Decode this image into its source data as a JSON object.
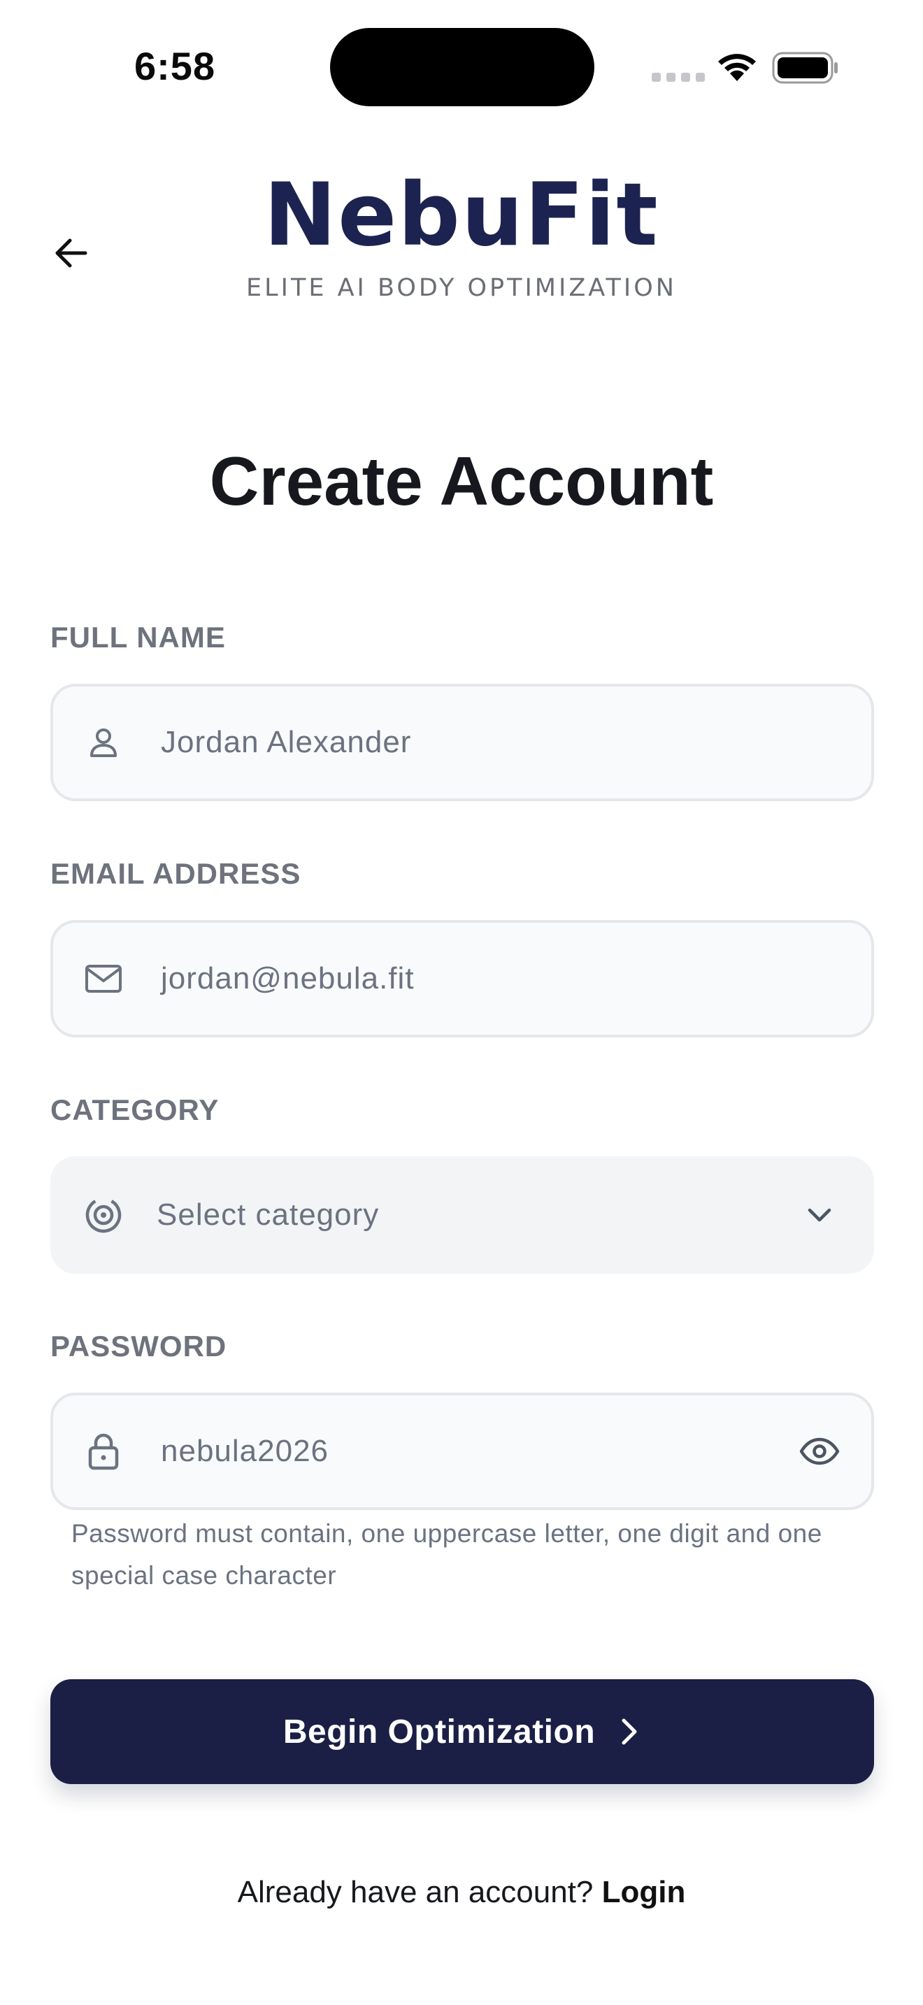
{
  "status_bar": {
    "time": "6:58"
  },
  "brand": {
    "logo": "NebuFit",
    "tagline": "ELITE AI BODY OPTIMIZATION"
  },
  "page": {
    "title": "Create Account"
  },
  "form": {
    "full_name": {
      "label": "FULL NAME",
      "value": "Jordan Alexander",
      "icon": "person-icon"
    },
    "email": {
      "label": "EMAIL ADDRESS",
      "value": "jordan@nebula.fit",
      "icon": "mail-icon"
    },
    "category": {
      "label": "CATEGORY",
      "placeholder": "Select category",
      "icon": "target-icon"
    },
    "password": {
      "label": "PASSWORD",
      "value": "nebula2026",
      "icon": "lock-icon",
      "hint": "Password must contain, one uppercase letter, one digit and one special case character"
    }
  },
  "cta": {
    "label": "Begin Optimization"
  },
  "footer": {
    "prompt": "Already have an account?",
    "link": "Login"
  },
  "colors": {
    "brand_navy": "#1b1f45",
    "logo_navy": "#1d2350",
    "muted_text": "#6b7280",
    "field_border": "#e5e7eb"
  }
}
